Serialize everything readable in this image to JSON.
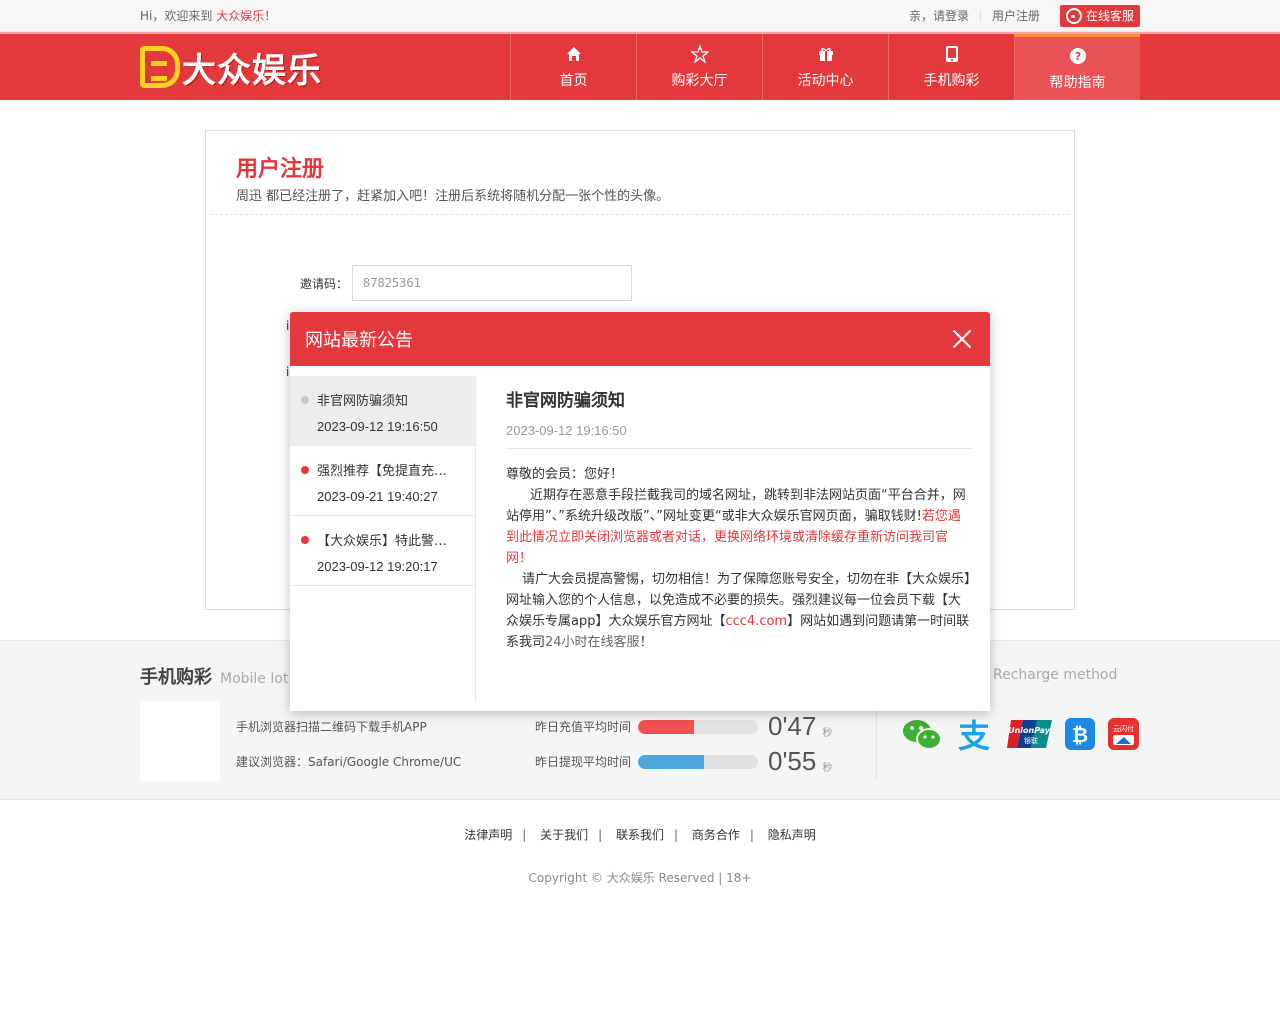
{
  "topbar": {
    "welcome_prefix": "Hi，欢迎来到",
    "brand": "大众娱乐",
    "welcome_suffix": "！",
    "login": "亲，请登录",
    "register": "用户注册",
    "service": "在线客服"
  },
  "header": {
    "logo_text": "大众娱乐",
    "nav": [
      {
        "label": "首页",
        "icon": "home-icon"
      },
      {
        "label": "购彩大厅",
        "icon": "star-icon"
      },
      {
        "label": "活动中心",
        "icon": "gift-icon"
      },
      {
        "label": "手机购彩",
        "icon": "mobile-icon"
      },
      {
        "label": "帮助指南",
        "icon": "help-icon"
      }
    ],
    "active_index": 4
  },
  "register": {
    "title": "用户注册",
    "subtitle": "周迅 都已经注册了，赶紧加入吧！注册后系统将随机分配一张个性的头像。",
    "invite_label": "邀请码：",
    "invite_value": "87825361",
    "hidden_label_char": "i"
  },
  "strip": {
    "mobile_title": "手机购彩",
    "mobile_title_en": "Mobile lot",
    "mobile_line1": "手机浏览器扫描二维码下载手机APP",
    "mobile_line2": "建议浏览器：Safari/Google Chrome/UC",
    "recharge_en": "Recharge method",
    "stats": [
      {
        "label": "昨日充值平均时间",
        "value": "0'47",
        "unit": "秒",
        "fill": 0.47,
        "color": "#f05050"
      },
      {
        "label": "昨日提现平均时间",
        "value": "0'55",
        "unit": "秒",
        "fill": 0.55,
        "color": "#4aa8dc"
      }
    ],
    "payments": [
      {
        "name": "wechat-pay-icon",
        "color": "#3cb034"
      },
      {
        "name": "alipay-icon",
        "color": "#1ba1e6"
      },
      {
        "name": "unionpay-icon",
        "color": "#d8202a",
        "text": "UnionPay",
        "subtext": "银联"
      },
      {
        "name": "bitcoin-icon",
        "color": "#1e88e5",
        "text": "₿"
      },
      {
        "name": "cloud-quickpass-icon",
        "color": "#e83030",
        "text": "云闪付"
      }
    ]
  },
  "footer": {
    "links": [
      "法律声明",
      "关于我们",
      "联系我们",
      "商务合作",
      "隐私声明"
    ],
    "copyright": "Copyright © 大众娱乐 Reserved | 18+"
  },
  "modal": {
    "title": "网站最新公告",
    "items": [
      {
        "title": "非官网防骗须知",
        "date": "2023-09-12 19:16:50",
        "active": true
      },
      {
        "title": "强烈推荐【免提直充…",
        "date": "2023-09-21 19:40:27",
        "active": false
      },
      {
        "title": "【大众娱乐】特此警…",
        "date": "2023-09-12 19:20:17",
        "active": false
      }
    ],
    "content": {
      "title": "非官网防骗须知",
      "date": "2023-09-12 19:16:50",
      "greeting": "尊敬的会员：您好！",
      "p1": "近期存在恶意手段拦截我司的域名网址，跳转到非法网站页面“平台合并，网站停用”、”系统升级改版”、”网址变更“或非大众娱乐官网页面，骗取钱财!",
      "p1_red": "若您遇到此情况立即关闭浏览器或者对话，更换网络环境或清除缓存重新访问我司官网！",
      "p2a": "请广大会员提高警惕，切勿相信！为了保障您账号安全，切勿在非【大众娱乐】网址输入您的个人信息，以免造成不必要的损失。强烈建议每一位会员下载【大众娱乐专属app】大众娱乐官方网址【",
      "p2_link": "ccc4.com",
      "p2b": "】网站如遇到问题请第一时间联系我司",
      "p2_service": "24小时在线客服",
      "p2c": "！"
    }
  }
}
